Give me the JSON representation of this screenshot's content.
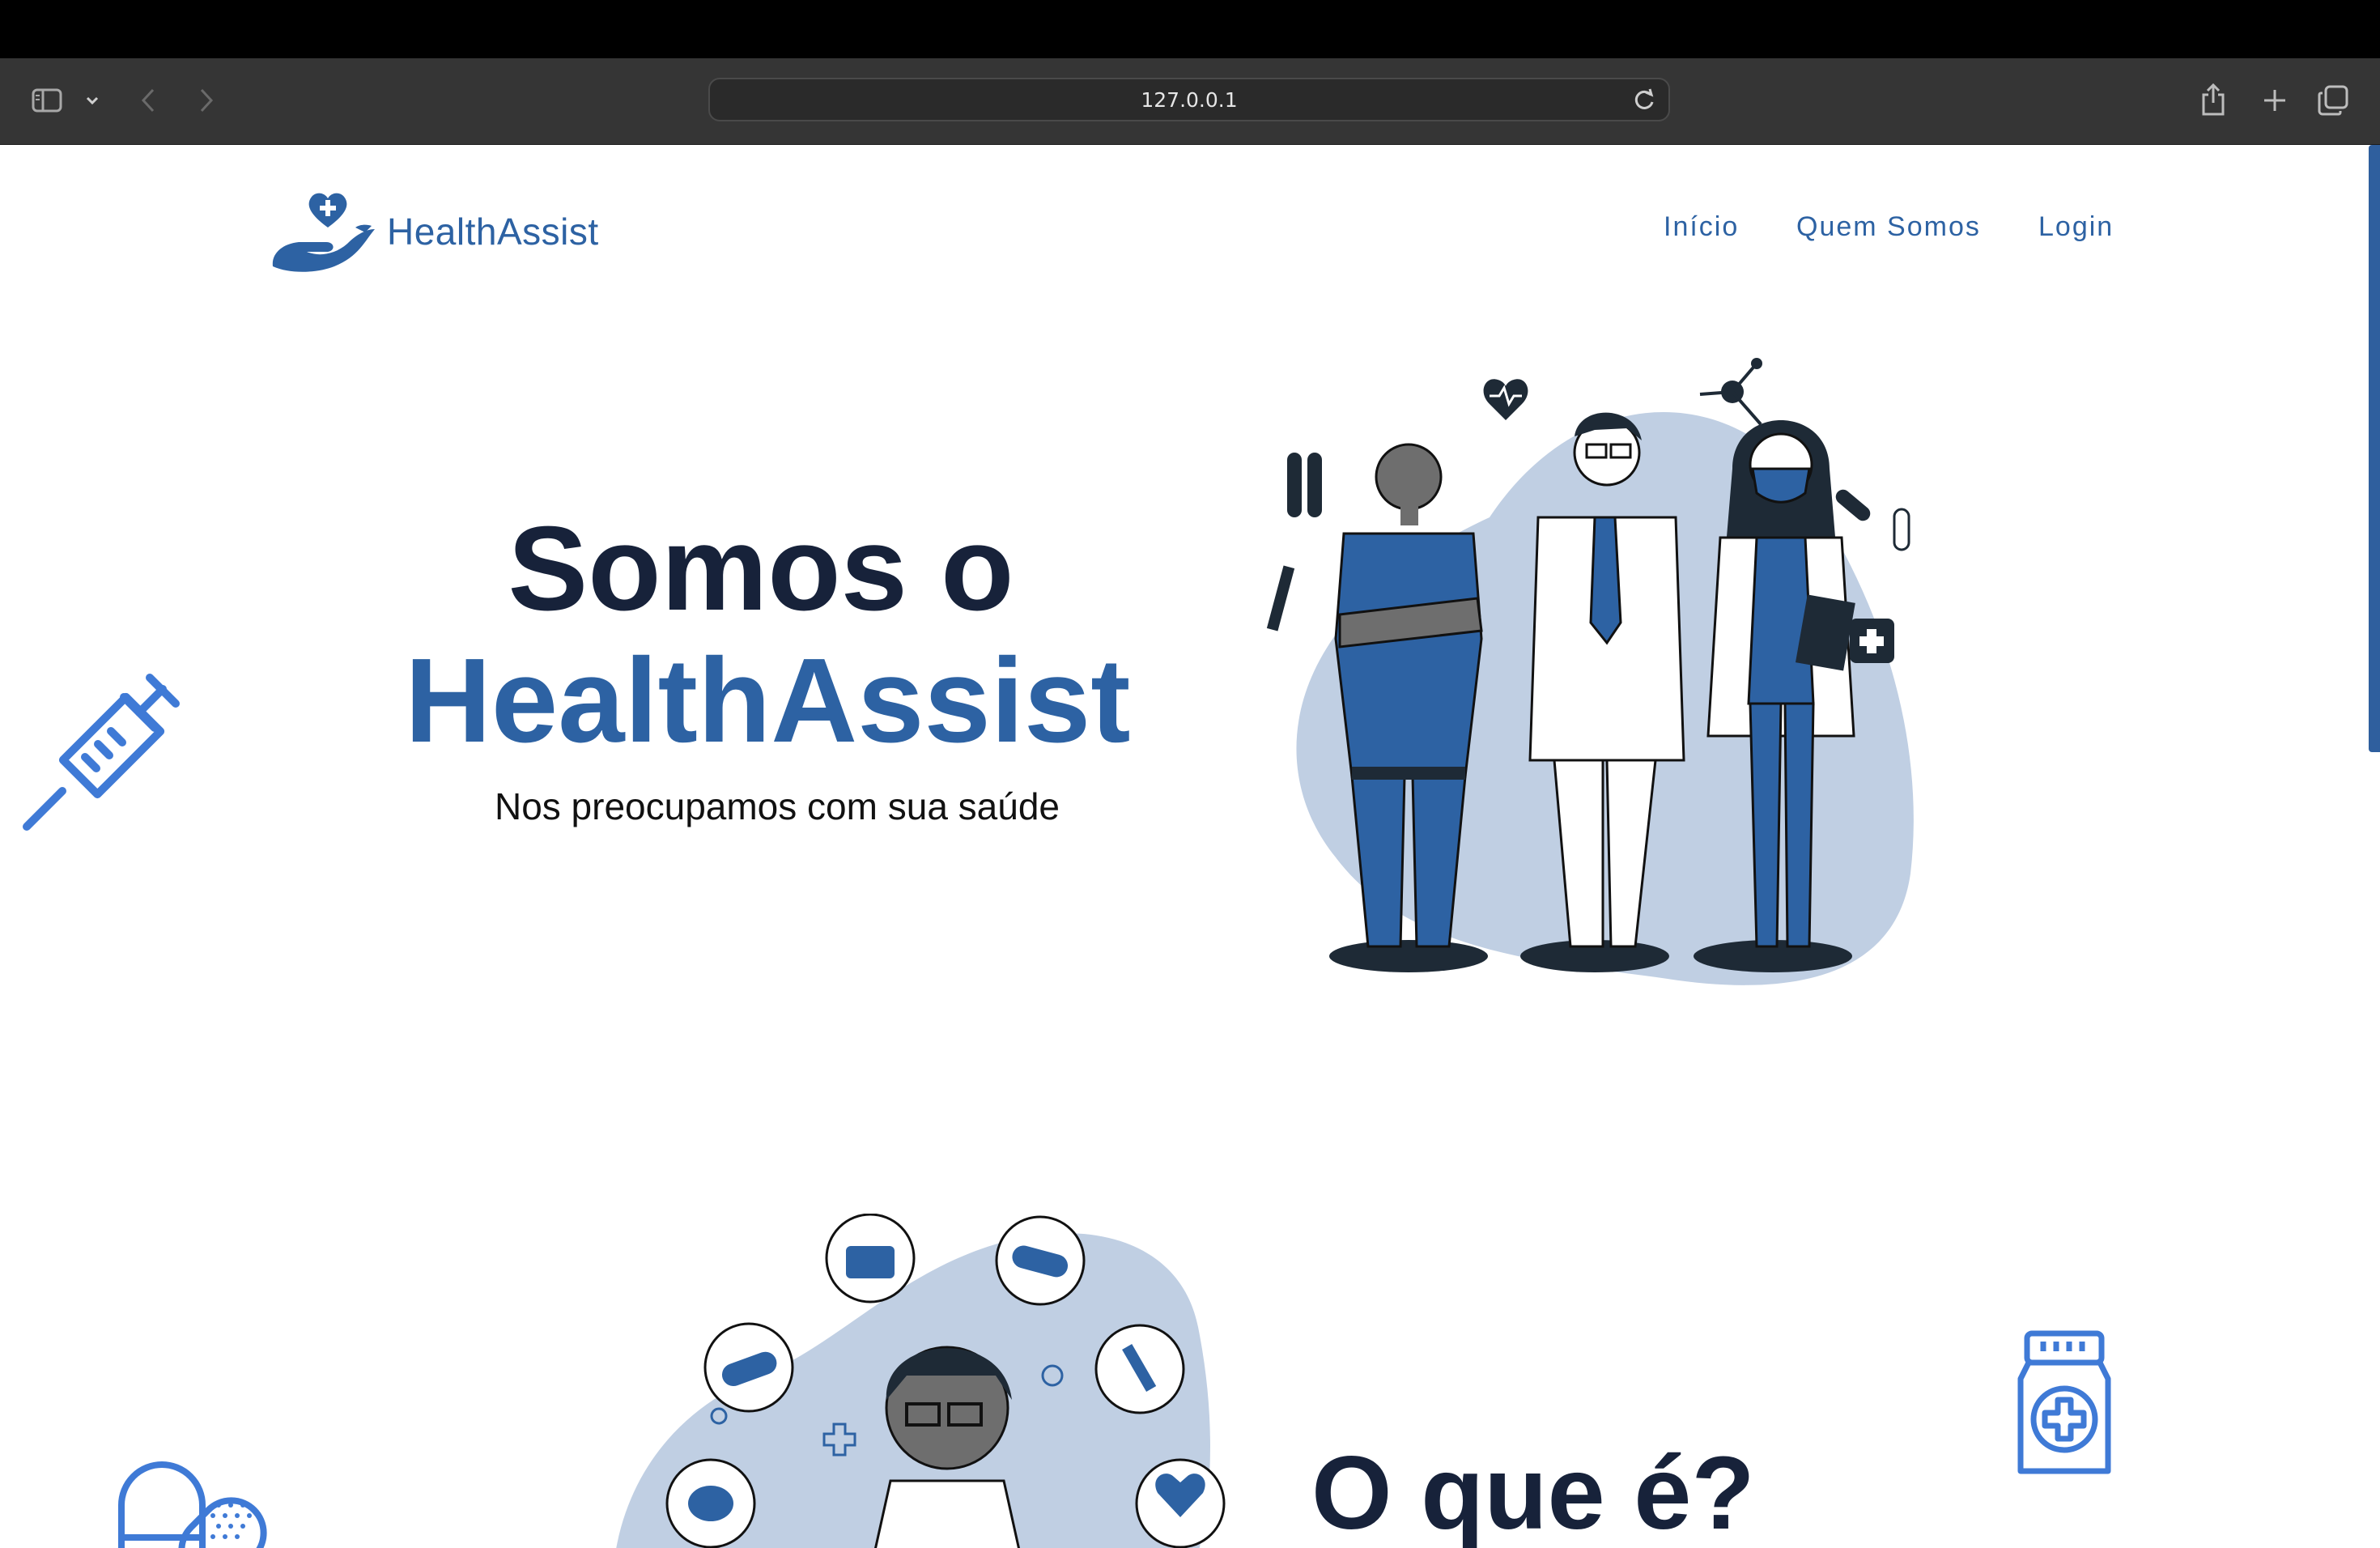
{
  "browser": {
    "url": "127.0.0.1"
  },
  "header": {
    "brand": "HealthAssist",
    "nav": [
      {
        "label": "Início"
      },
      {
        "label": "Quem Somos"
      },
      {
        "label": "Login"
      }
    ]
  },
  "hero": {
    "title_line1": "Somos o",
    "title_line2": "HealthAssist",
    "subtitle": "Nos preocupamos com sua saúde"
  },
  "section2": {
    "title": "O que é?"
  },
  "colors": {
    "brand_blue": "#2d62a3",
    "dark_navy": "#17223a",
    "blob": "#c0cfe3"
  },
  "icons": [
    "sidebar-icon",
    "chevron-down-icon",
    "back-icon",
    "forward-icon",
    "reload-icon",
    "share-icon",
    "plus-icon",
    "tabs-icon",
    "syringe-icon",
    "medicine-bottle-icon",
    "pill-bandage-icon",
    "heart-hand-logo-icon"
  ]
}
